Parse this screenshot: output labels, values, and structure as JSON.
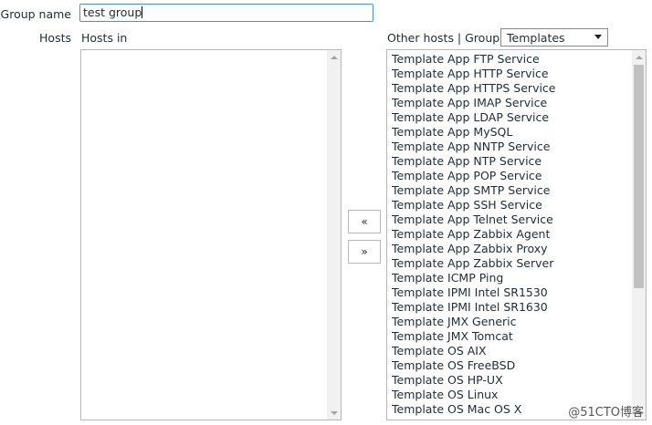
{
  "form": {
    "group_name_label": "Group name",
    "group_name_value": "test group",
    "hosts_label": "Hosts",
    "hosts_in_label": "Hosts in",
    "hosts_in_items": [],
    "other_hosts_label": "Other hosts | Group",
    "group_select_value": "Templates",
    "move_left_label": "«",
    "move_right_label": "»",
    "other_hosts_items": [
      "Template App FTP Service",
      "Template App HTTP Service",
      "Template App HTTPS Service",
      "Template App IMAP Service",
      "Template App LDAP Service",
      "Template App MySQL",
      "Template App NNTP Service",
      "Template App NTP Service",
      "Template App POP Service",
      "Template App SMTP Service",
      "Template App SSH Service",
      "Template App Telnet Service",
      "Template App Zabbix Agent",
      "Template App Zabbix Proxy",
      "Template App Zabbix Server",
      "Template ICMP Ping",
      "Template IPMI Intel SR1530",
      "Template IPMI Intel SR1630",
      "Template JMX Generic",
      "Template JMX Tomcat",
      "Template OS AIX",
      "Template OS FreeBSD",
      "Template OS HP-UX",
      "Template OS Linux",
      "Template OS Mac OS X"
    ]
  },
  "watermark": "@51CTO博客",
  "colors": {
    "input_border": "#4d90c9",
    "listbox_border": "#b7b7b7",
    "text": "#1f2c33",
    "scroll_thumb": "#c1c1c1"
  },
  "icons": {
    "scroll_up": "triangle-up",
    "scroll_down": "triangle-down",
    "select_caret": "triangle-down"
  }
}
